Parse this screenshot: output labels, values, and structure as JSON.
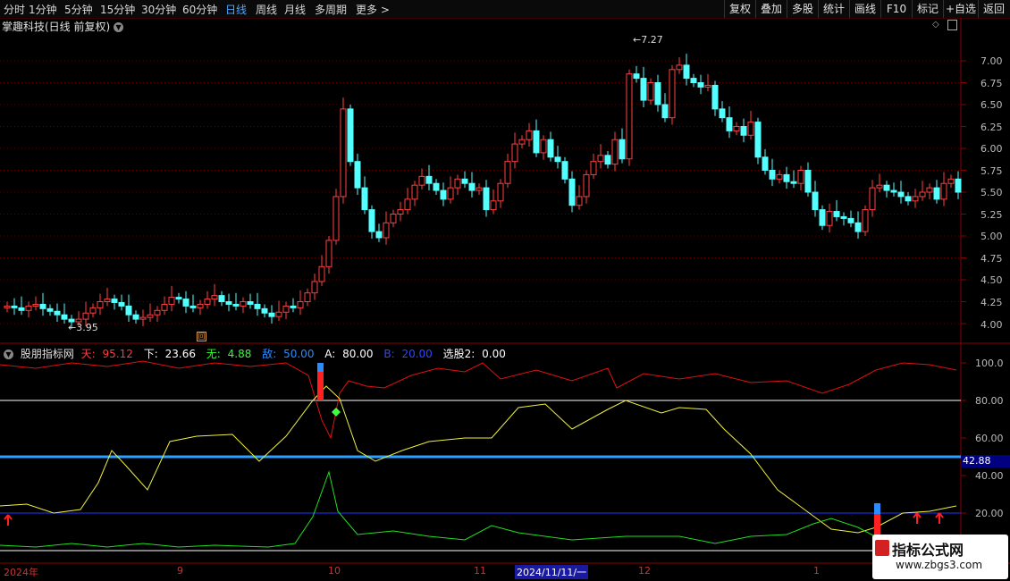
{
  "toolbar": {
    "timeframes": [
      "分时",
      "1分钟",
      "5分钟",
      "15分钟",
      "30分钟",
      "60分钟",
      "日线",
      "周线",
      "月线",
      "多周期",
      "更多 >"
    ],
    "active_timeframe": "日线",
    "right_buttons": [
      "复权",
      "叠加",
      "多股",
      "统计",
      "画线",
      "F10",
      "标记",
      "+自选",
      "返回"
    ]
  },
  "main_chart": {
    "title": "掌趣科技(日线 前复权)",
    "y_ticks": [
      "7.00",
      "6.75",
      "6.50",
      "6.25",
      "6.00",
      "5.75",
      "5.50",
      "5.25",
      "5.00",
      "4.75",
      "4.50",
      "4.25",
      "4.00"
    ],
    "y_min": 3.9,
    "y_max": 7.3,
    "high_label": "7.27",
    "low_label": "3.95",
    "colors": {
      "up": "#ff4040",
      "down": "#54ffff"
    }
  },
  "indicator": {
    "name": "股朋指标网",
    "values": [
      {
        "label": "天:",
        "value": "95.12",
        "color": "#ff3b3b"
      },
      {
        "label": "下:",
        "value": "23.66",
        "color": "#ffffff"
      },
      {
        "label": "无:",
        "value": "4.88",
        "color": "#33ff33"
      },
      {
        "label": "敌:",
        "value": "50.00",
        "color": "#2a8cff"
      },
      {
        "label": "A:",
        "value": "80.00",
        "color": "#ffffff"
      },
      {
        "label": "B:",
        "value": "20.00",
        "color": "#3344ff"
      },
      {
        "label": "选股2:",
        "value": "0.00",
        "color": "#ffffff"
      }
    ],
    "y_ticks": [
      "100.0",
      "80.00",
      "60.00",
      "40.00",
      "20.00"
    ],
    "current_badge": "42.88",
    "lines": {
      "red_tian": 95.12,
      "level_a": 80,
      "level_di": 50,
      "level_b": 20
    }
  },
  "x_axis": {
    "labels": [
      "2024年",
      "9",
      "10",
      "11",
      "2024/11/11/一",
      "12",
      "1"
    ]
  },
  "watermark": {
    "line1": "指标公式网",
    "line2": "www.zbgs3.com"
  }
}
